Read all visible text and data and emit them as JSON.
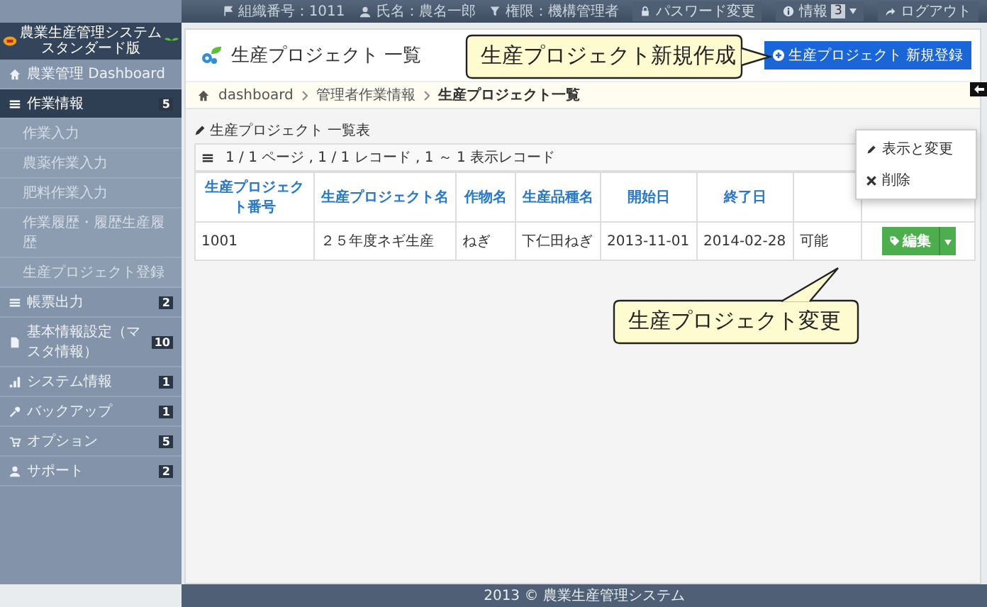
{
  "top_bar": {
    "items": [
      {
        "label": "組織番号：1011"
      },
      {
        "label": "氏名：農名一郎"
      },
      {
        "label": "権限：機構管理者"
      }
    ],
    "buttons": [
      {
        "label": "パスワード変更"
      },
      {
        "label": "情報",
        "badge": "3"
      },
      {
        "label": "ログアウト"
      }
    ]
  },
  "logo": {
    "line_1": "農業生産管理システム",
    "line_2": "スタンダード版"
  },
  "sidebar": {
    "items": [
      {
        "label": "農業管理 Dashboard",
        "selected": false
      },
      {
        "label": "作業情報",
        "badge": "5",
        "selected": true,
        "expanded": true,
        "children": [
          {
            "label": "作業入力",
            "selected": false
          },
          {
            "label": "農薬作業入力",
            "selected": false
          },
          {
            "label": "肥料作業入力",
            "selected": false
          },
          {
            "label": "作業履歴・履歴生産履歴",
            "selected": false
          },
          {
            "label": "生産プロジェクト登録",
            "selected": false
          }
        ]
      },
      {
        "label": "帳票出力",
        "badge": "2",
        "selected": false
      },
      {
        "label": "基本情報設定（マスタ情報）",
        "badge": "10",
        "selected": false
      },
      {
        "label": "システム情報",
        "badge": "1",
        "selected": false
      },
      {
        "label": "バックアップ",
        "badge": "1",
        "selected": false
      },
      {
        "label": "オプション",
        "badge": "5",
        "selected": false
      },
      {
        "label": "サポート",
        "badge": "2",
        "selected": false
      }
    ]
  },
  "page": {
    "title": "生産プロジェクト 一覧",
    "new_button": "生産プロジェクト 新規登録",
    "breadcrumb": [
      "dashboard",
      "管理者作業情報",
      "生産プロジェクト一覧"
    ]
  },
  "table": {
    "caption": "生産プロジェクト 一覧表",
    "pager": "1 / 1 ページ , 1 / 1 レコード , 1 ～ 1 表示レコード",
    "columns": [
      "生産プロジェクト番号",
      "生産プロジェクト名",
      "作物名",
      "生産品種名",
      "開始日",
      "終了日"
    ],
    "rows": [
      {
        "cells": [
          "1001",
          "２５年度ネギ生産",
          "ねぎ",
          "下仁田ねぎ",
          "2013-11-01",
          "2014-02-28",
          "可能"
        ],
        "action": "編集"
      }
    ]
  },
  "row_menu": {
    "items": [
      {
        "label": "表示と変更",
        "kind": "edit"
      },
      {
        "label": "削除",
        "kind": "delete"
      }
    ]
  },
  "callouts": [
    {
      "text": "生産プロジェクト新規作成",
      "kind": "right"
    },
    {
      "text": "生産プロジェクト変更",
      "kind": "up"
    }
  ],
  "footer": "2013 © 農業生産管理システム"
}
